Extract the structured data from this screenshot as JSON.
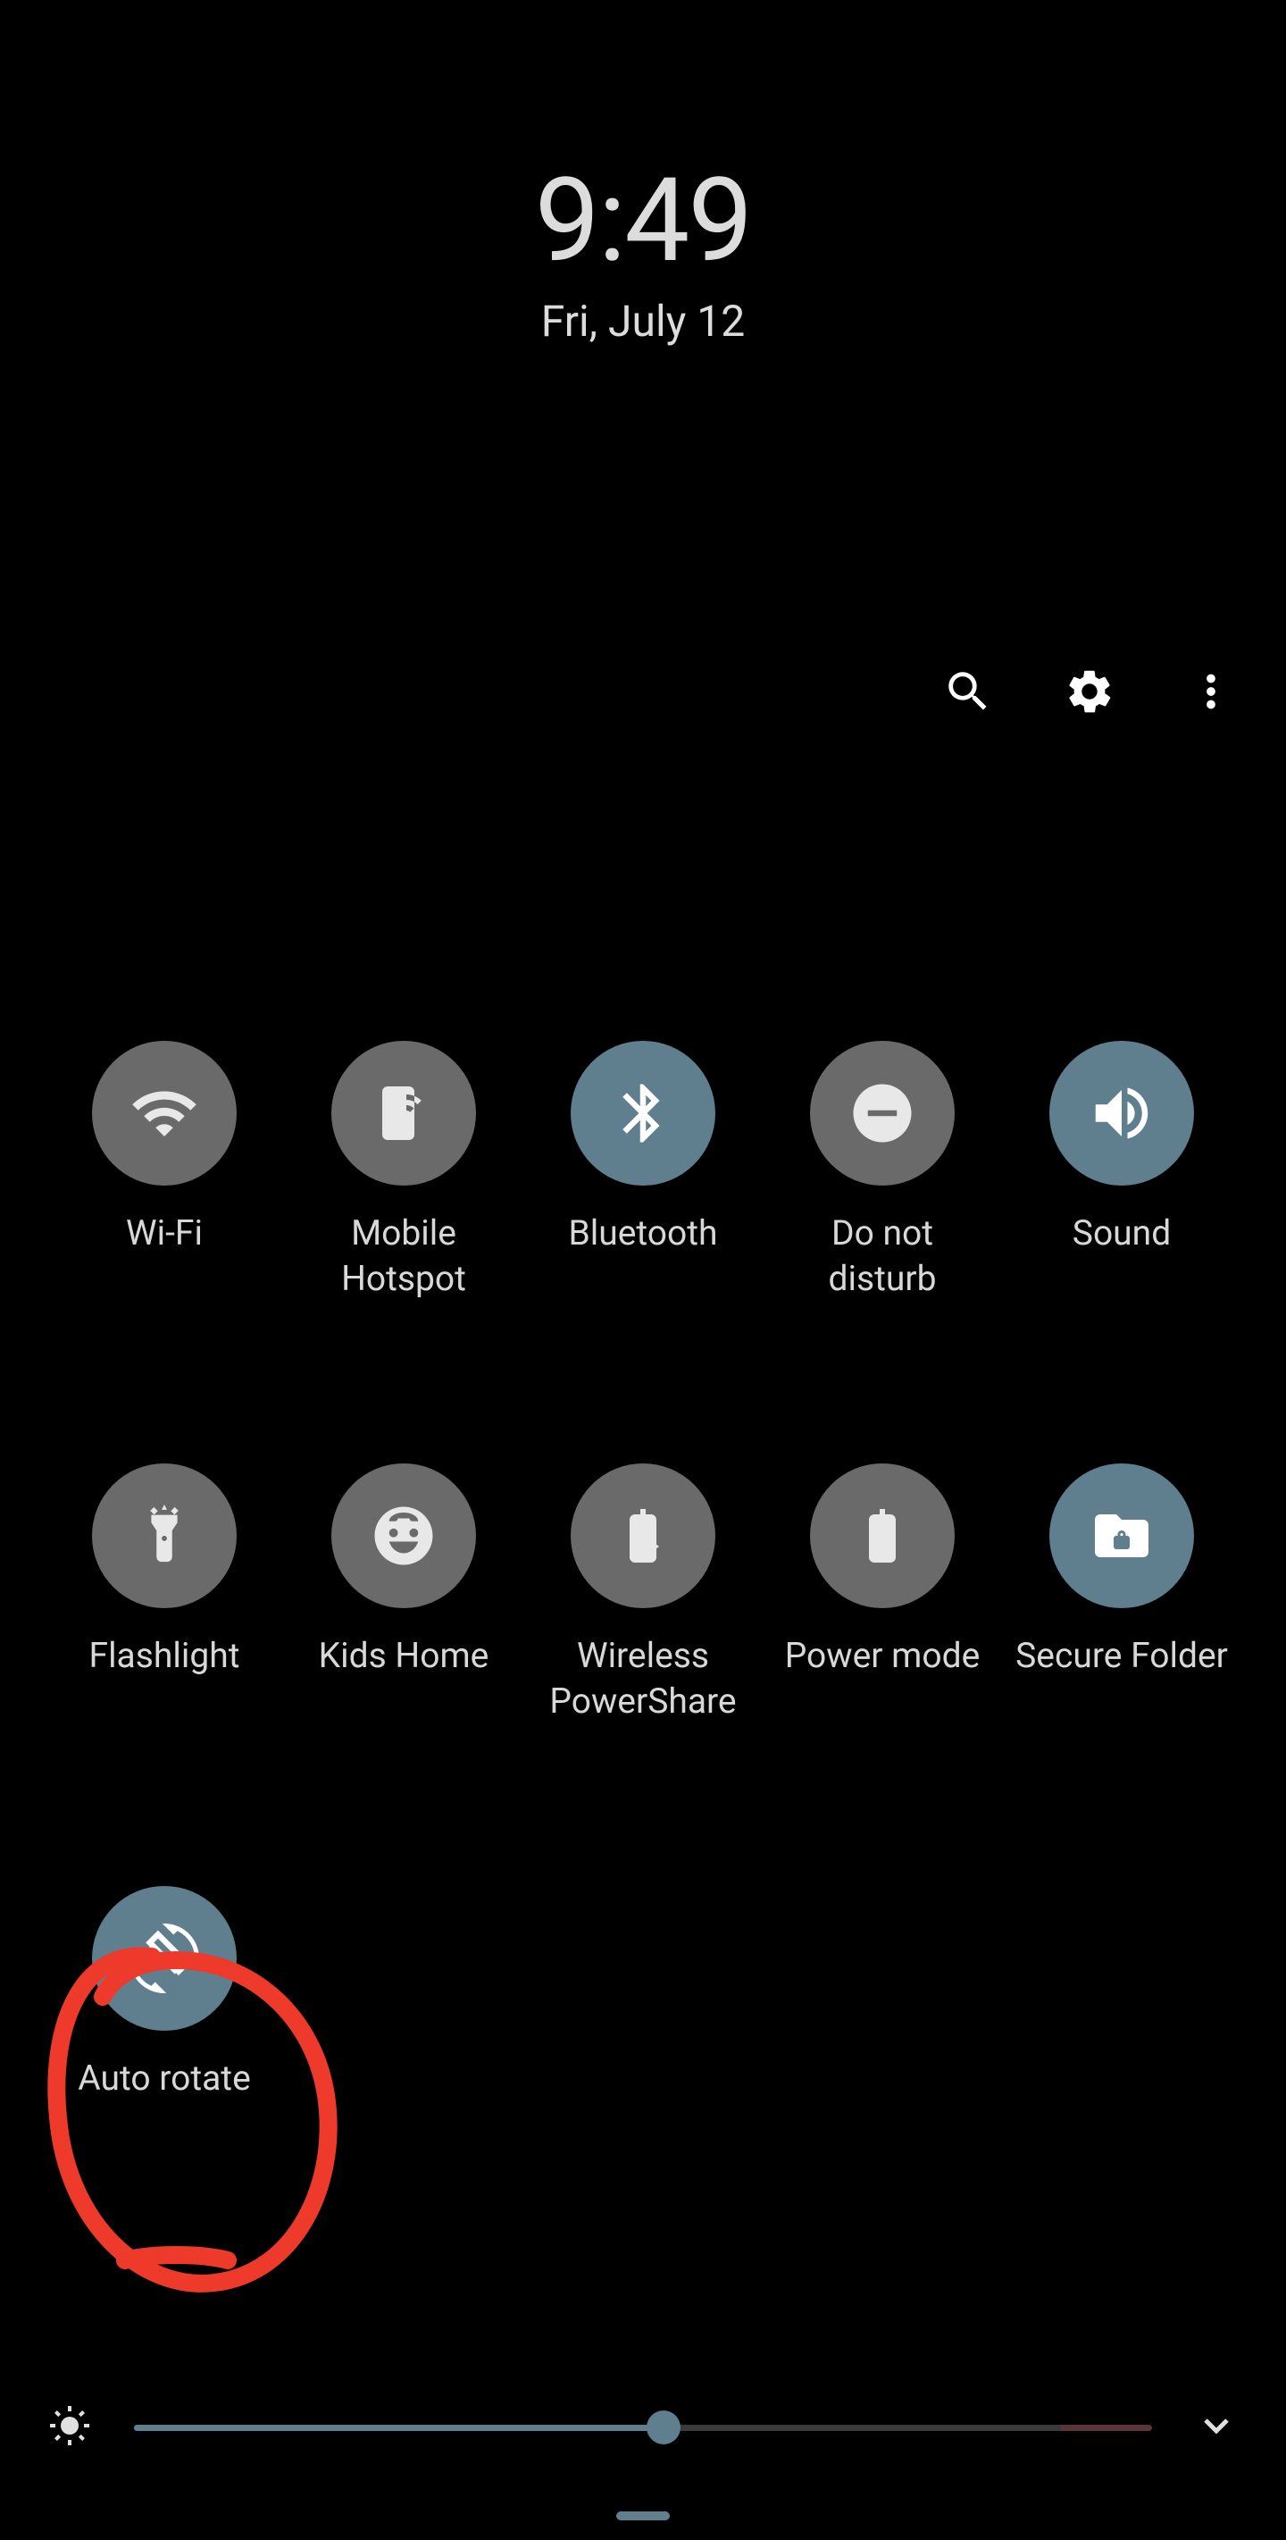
{
  "clock": {
    "time": "9:49",
    "date": "Fri, July 12"
  },
  "header": {
    "search_icon": "search-icon",
    "settings_icon": "gear-icon",
    "more_icon": "more-vertical-icon"
  },
  "tiles": [
    {
      "id": "wifi",
      "label": "Wi-Fi",
      "active": false,
      "icon": "wifi-icon"
    },
    {
      "id": "mobile-hotspot",
      "label": "Mobile Hotspot",
      "active": false,
      "icon": "hotspot-icon"
    },
    {
      "id": "bluetooth",
      "label": "Bluetooth",
      "active": true,
      "icon": "bluetooth-icon"
    },
    {
      "id": "dnd",
      "label": "Do not disturb",
      "active": false,
      "icon": "dnd-icon"
    },
    {
      "id": "sound",
      "label": "Sound",
      "active": true,
      "icon": "sound-icon"
    },
    {
      "id": "flashlight",
      "label": "Flashlight",
      "active": false,
      "icon": "flashlight-icon"
    },
    {
      "id": "kids-home",
      "label": "Kids Home",
      "active": false,
      "icon": "kids-home-icon"
    },
    {
      "id": "wireless-ps",
      "label": "Wireless PowerShare",
      "active": false,
      "icon": "wireless-powershare-icon"
    },
    {
      "id": "power-mode",
      "label": "Power mode",
      "active": false,
      "icon": "power-mode-icon"
    },
    {
      "id": "secure-folder",
      "label": "Secure Folder",
      "active": true,
      "icon": "secure-folder-icon"
    },
    {
      "id": "auto-rotate",
      "label": "Auto rotate",
      "active": true,
      "icon": "auto-rotate-icon"
    }
  ],
  "brightness": {
    "percent": 52
  },
  "colors": {
    "off": "#6a6a6a",
    "on": "#5f7e8e",
    "annotation": "#ee3a2a"
  }
}
